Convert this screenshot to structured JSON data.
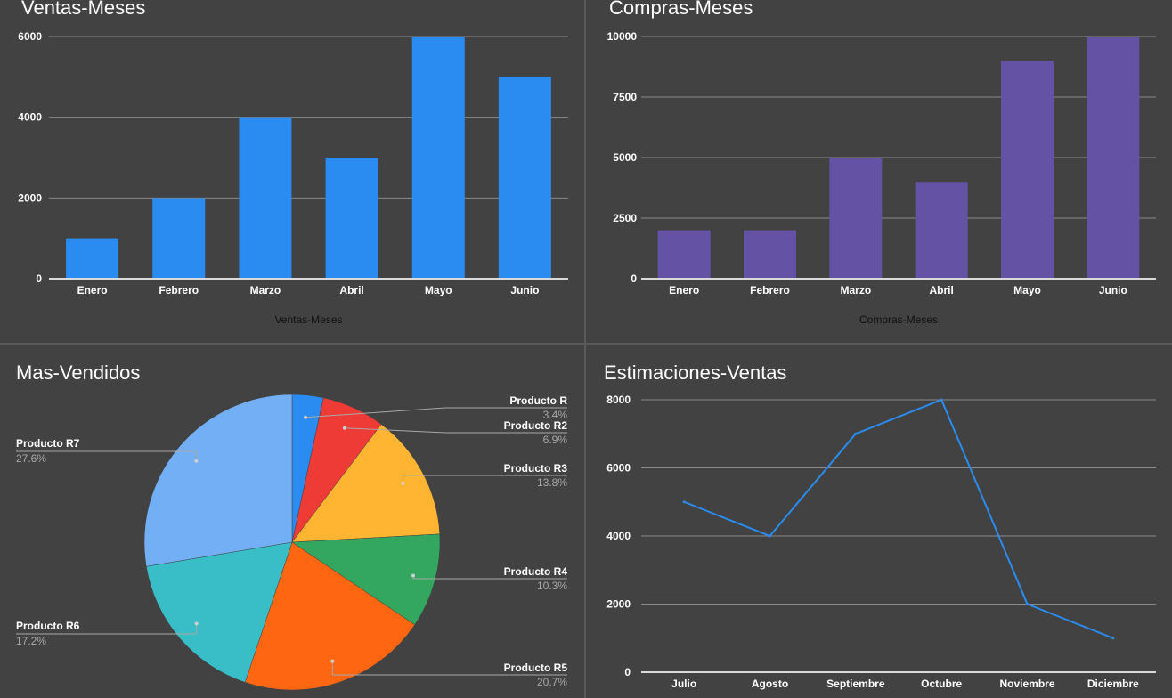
{
  "chart_data": [
    {
      "id": "ventas",
      "type": "bar",
      "title": "Ventas-Meses",
      "xlabel": "Ventas-Meses",
      "ylabel": "",
      "categories": [
        "Enero",
        "Febrero",
        "Marzo",
        "Abril",
        "Mayo",
        "Junio"
      ],
      "values": [
        1000,
        2000,
        4000,
        3000,
        6000,
        5000
      ],
      "ylim": [
        0,
        6000
      ],
      "yticks": [
        0,
        2000,
        4000,
        6000
      ],
      "color": "#2a8cf0",
      "grid": true
    },
    {
      "id": "compras",
      "type": "bar",
      "title": "Compras-Meses",
      "xlabel": "Compras-Meses",
      "ylabel": "",
      "categories": [
        "Enero",
        "Febrero",
        "Marzo",
        "Abril",
        "Mayo",
        "Junio"
      ],
      "values": [
        2000,
        2000,
        5000,
        4000,
        9000,
        10000
      ],
      "ylim": [
        0,
        10000
      ],
      "yticks": [
        0,
        2500,
        5000,
        7500,
        10000
      ],
      "color": "#6453a4",
      "grid": true
    },
    {
      "id": "vendidos",
      "type": "pie",
      "title": "Mas-Vendidos",
      "slices": [
        {
          "label": "Producto R",
          "pct": "3.4%",
          "value": 3.4,
          "color": "#2a8cf0"
        },
        {
          "label": "Producto R2",
          "pct": "6.9%",
          "value": 6.9,
          "color": "#ef3b36"
        },
        {
          "label": "Producto R3",
          "pct": "13.8%",
          "value": 13.8,
          "color": "#ffb531"
        },
        {
          "label": "Producto R4",
          "pct": "10.3%",
          "value": 10.3,
          "color": "#33a660"
        },
        {
          "label": "Producto R5",
          "pct": "20.7%",
          "value": 20.7,
          "color": "#ff6612"
        },
        {
          "label": "Producto R6",
          "pct": "17.2%",
          "value": 17.2,
          "color": "#39bec8"
        },
        {
          "label": "Producto R7",
          "pct": "27.6%",
          "value": 27.6,
          "color": "#72aff5"
        }
      ]
    },
    {
      "id": "estimaciones",
      "type": "line",
      "title": "Estimaciones-Ventas",
      "xlabel": "",
      "ylabel": "",
      "categories": [
        "Julio",
        "Agosto",
        "Septiembre",
        "Octubre",
        "Noviembre",
        "Diciembre"
      ],
      "values": [
        5000,
        4000,
        7000,
        8000,
        2000,
        1000
      ],
      "ylim": [
        0,
        8000
      ],
      "yticks": [
        0,
        2000,
        4000,
        6000,
        8000
      ],
      "color": "#2a8cf0",
      "grid": true
    }
  ]
}
